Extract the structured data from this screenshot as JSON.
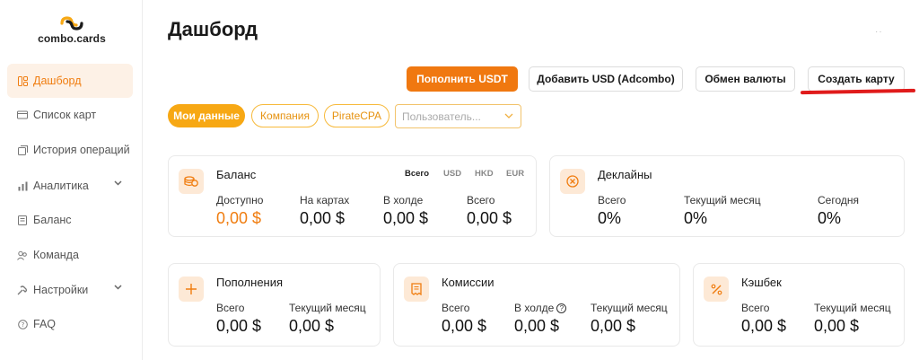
{
  "brand": {
    "name": "combo.cards"
  },
  "sidebar": {
    "items": [
      {
        "label": "Дашборд",
        "icon": "dashboard-icon"
      },
      {
        "label": "Список карт",
        "icon": "cards-icon"
      },
      {
        "label": "История операций",
        "icon": "history-icon"
      },
      {
        "label": "Аналитика",
        "icon": "analytics-icon"
      },
      {
        "label": "Баланс",
        "icon": "balance-icon"
      },
      {
        "label": "Команда",
        "icon": "team-icon"
      },
      {
        "label": "Настройки",
        "icon": "settings-icon"
      },
      {
        "label": "FAQ",
        "icon": "faq-icon"
      }
    ]
  },
  "header": {
    "title": "Дашборд"
  },
  "actions": {
    "topup_usdt": "Пополнить USDT",
    "add_usd": "Добавить USD (Adcombo)",
    "exchange": "Обмен валюты",
    "create_card": "Создать карту"
  },
  "filters": {
    "my_data": "Мои данные",
    "company": "Компания",
    "piratecpa": "PirateCPA",
    "user_placeholder": "Пользователь..."
  },
  "balance": {
    "title": "Баланс",
    "currencies": [
      "Всего",
      "USD",
      "HKD",
      "EUR"
    ],
    "stats": [
      {
        "label": "Доступно",
        "value": "0,00 $"
      },
      {
        "label": "На картах",
        "value": "0,00 $"
      },
      {
        "label": "В холде",
        "value": "0,00 $"
      },
      {
        "label": "Всего",
        "value": "0,00 $"
      }
    ]
  },
  "declines": {
    "title": "Деклайны",
    "stats": [
      {
        "label": "Всего",
        "value": "0%"
      },
      {
        "label": "Текущий месяц",
        "value": "0%"
      },
      {
        "label": "Сегодня",
        "value": "0%"
      }
    ]
  },
  "topups": {
    "title": "Пополнения",
    "stats": [
      {
        "label": "Всего",
        "value": "0,00 $"
      },
      {
        "label": "Текущий месяц",
        "value": "0,00 $"
      }
    ]
  },
  "commissions": {
    "title": "Комиссии",
    "stats": [
      {
        "label": "Всего",
        "value": "0,00 $"
      },
      {
        "label": "В холде",
        "value": "0,00 $"
      },
      {
        "label": "Текущий месяц",
        "value": "0,00 $"
      }
    ]
  },
  "cashback": {
    "title": "Кэшбек",
    "stats": [
      {
        "label": "Всего",
        "value": "0,00 $"
      },
      {
        "label": "Текущий месяц",
        "value": "0,00 $"
      }
    ]
  },
  "colors": {
    "accent": "#f07810",
    "accent_soft": "#fde9d6",
    "highlight": "#e01b1b"
  }
}
